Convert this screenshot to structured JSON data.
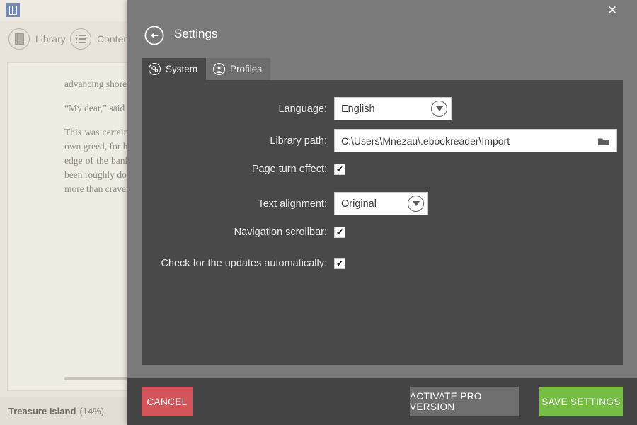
{
  "background_app": {
    "logo_icon": "book-app-logo-icon",
    "toolbar": [
      {
        "label": "Library",
        "icon": "book-icon"
      },
      {
        "label": "Content",
        "icon": "list-icon"
      }
    ],
    "reader_text": [
      "advancing sho… a lantern.",
      "“My dear,” sai… and run on. I a…",
      "This was cert… How I cursed … blamed my p… greed, for h… weakness! We… fortune; and I … edge of the ba… and fell on my… the strength to… roughly done, … bank and a litt… not move her, … more than crav… my mother al…"
    ],
    "status": {
      "book_title": "Treasure Island",
      "progress": "(14%)"
    }
  },
  "dialog": {
    "title": "Settings",
    "close_icon": "close-icon",
    "back_icon": "back-arrow-icon",
    "tabs": [
      {
        "label": "System",
        "icon": "gears-icon",
        "active": true
      },
      {
        "label": "Profiles",
        "icon": "user-icon",
        "active": false
      }
    ],
    "form": {
      "language": {
        "label": "Language:",
        "value": "English",
        "caret_icon": "chevron-down-icon"
      },
      "library_path": {
        "label": "Library path:",
        "value": "C:\\Users\\Mnezau\\.ebookreader\\Import",
        "browse_icon": "folder-icon"
      },
      "page_turn_effect": {
        "label": "Page turn effect:",
        "checked": true,
        "check_glyph": "✔"
      },
      "text_alignment": {
        "label": "Text alignment:",
        "value": "Original",
        "caret_icon": "chevron-down-icon"
      },
      "navigation_scrollbar": {
        "label": "Navigation scrollbar:",
        "checked": true,
        "check_glyph": "✔"
      },
      "check_updates": {
        "label": "Check for the updates automatically:",
        "checked": true,
        "check_glyph": "✔"
      }
    },
    "footer": {
      "cancel_label": "CANCEL",
      "activate_pro_label": "ACTIVATE PRO VERSION",
      "save_label": "SAVE SETTINGS"
    }
  },
  "colors": {
    "dialog_header": "#7a7a7a",
    "panel": "#494949",
    "footer": "#444444",
    "cancel": "#d3555a",
    "save": "#76bd43",
    "pro": "#6e6e6e",
    "app_bg": "#e8e4dc"
  }
}
